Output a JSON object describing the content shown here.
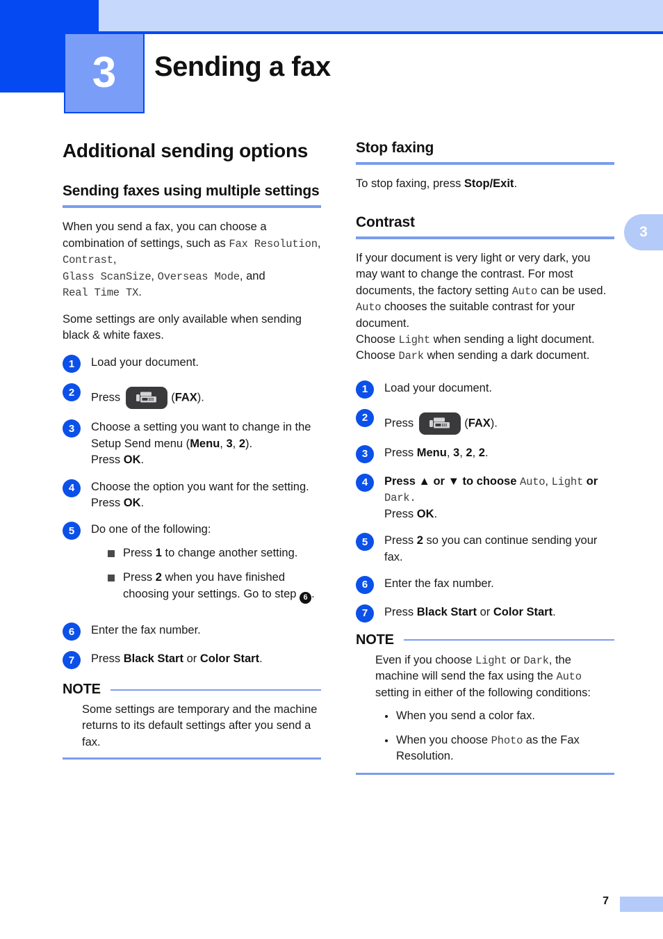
{
  "header": {
    "chapter_number": "3",
    "chapter_title": "Sending a fax"
  },
  "side_tab": {
    "label": "3"
  },
  "footer": {
    "page_number": "7"
  },
  "left_column": {
    "section_title": "Additional sending options",
    "subsection_title": "Sending faxes using multiple settings",
    "intro_p1_a": "When you send a fax, you can choose a combination of settings, such as ",
    "intro_p1_mono1": "Fax Resolution",
    "intro_p1_sep1": ", ",
    "intro_p1_mono2": "Contrast",
    "intro_p1_sep2": ", ",
    "intro_p1_mono3": "Glass ScanSize",
    "intro_p1_sep3": ", ",
    "intro_p1_mono4": "Overseas Mode",
    "intro_p1_b": ", and ",
    "intro_p1_mono5": "Real Time TX",
    "intro_p1_c": ".",
    "intro_p2": "Some settings are only available when sending black & white faxes.",
    "steps": [
      {
        "num": "1",
        "text": "Load your document."
      },
      {
        "num": "2",
        "press_label": "Press",
        "key_icon": "fax-machine-icon",
        "key_name": "FAX",
        "suffix": ")."
      },
      {
        "num": "3",
        "line1_a": "Choose a setting you want to change in the Setup Send menu (",
        "menu": "Menu",
        "comma1": ", ",
        "d3": "3",
        "comma2": ", ",
        "d2": "2",
        "close": ").",
        "line2_a": "Press ",
        "ok": "OK",
        "line2_b": "."
      },
      {
        "num": "4",
        "line1": "Choose the option you want for the setting.",
        "line2_a": "Press ",
        "ok": "OK",
        "line2_b": "."
      },
      {
        "num": "5",
        "text": "Do one of the following:",
        "bullets": [
          {
            "a": "Press ",
            "b": "1",
            "c": " to change another setting."
          },
          {
            "a": "Press ",
            "b": "2",
            "c": " when you have finished choosing your settings. Go to step ",
            "ref": "6",
            "d": "."
          }
        ]
      },
      {
        "num": "6",
        "text": "Enter the fax number."
      },
      {
        "num": "7",
        "a": "Press ",
        "b1": "Black Start",
        "mid": " or ",
        "b2": "Color Start",
        "c": "."
      }
    ],
    "note": {
      "title": "NOTE",
      "text": "Some settings are temporary and the machine returns to its default settings after you send a fax."
    }
  },
  "right_column": {
    "stop_faxing": {
      "title": "Stop faxing",
      "text_a": "To stop faxing, press ",
      "text_b": "Stop/Exit",
      "text_c": "."
    },
    "contrast": {
      "title": "Contrast",
      "p1_a": "If your document is very light or very dark, you may want to change the contrast. For most documents, the factory setting ",
      "p1_mono1": "Auto",
      "p1_b": " can be used. ",
      "p1_mono2": "Auto",
      "p1_c": " chooses the suitable contrast for your document.",
      "p2_a": "Choose ",
      "p2_mono1": "Light",
      "p2_b": " when sending a light document. Choose ",
      "p2_mono2": "Dark",
      "p2_c": " when sending a dark document.",
      "steps": [
        {
          "num": "1",
          "text": "Load your document."
        },
        {
          "num": "2",
          "press_label": "Press",
          "key_icon": "fax-machine-icon",
          "key_name": "FAX",
          "suffix": ")."
        },
        {
          "num": "3",
          "a": "Press ",
          "menu": "Menu",
          "c1": ", ",
          "d1": "3",
          "c2": ", ",
          "d2": "2",
          "c3": ", ",
          "d3": "2",
          "end": "."
        },
        {
          "num": "4",
          "l1_a": "Press ",
          "up": "▲",
          "l1_b": " or ",
          "down": "▼",
          "l1_c": " to choose ",
          "m1": "Auto",
          "l1_d": ", ",
          "m2": "Light",
          "l1_e": " or ",
          "m3": "Dark",
          "l1_f": ".",
          "l2_a": "Press ",
          "ok": "OK",
          "l2_b": "."
        },
        {
          "num": "5",
          "a": "Press ",
          "b": "2",
          "c": " so you can continue sending your fax."
        },
        {
          "num": "6",
          "text": "Enter the fax number."
        },
        {
          "num": "7",
          "a": "Press ",
          "b1": "Black Start",
          "mid": " or ",
          "b2": "Color Start",
          "c": "."
        }
      ],
      "note": {
        "title": "NOTE",
        "p_a": "Even if you choose ",
        "p_m1": "Light",
        "p_b": " or ",
        "p_m2": "Dark",
        "p_c": ", the machine will send the fax using the ",
        "p_m3": "Auto",
        "p_d": " setting in either of the following conditions:",
        "bullets": [
          {
            "a": "When you send a color fax.",
            "m": "",
            "b": ""
          },
          {
            "a": "When you choose ",
            "m": "Photo",
            "b": " as the Fax Resolution."
          }
        ]
      }
    }
  },
  "colors": {
    "brand_blue": "#0549f2",
    "light_blue_bar": "#c6d8fb",
    "rule_blue": "#7b9cf0",
    "step_circle": "#0b50e8",
    "chapter_box": "#7a9ef7",
    "fax_key": "#3a3a3c"
  }
}
